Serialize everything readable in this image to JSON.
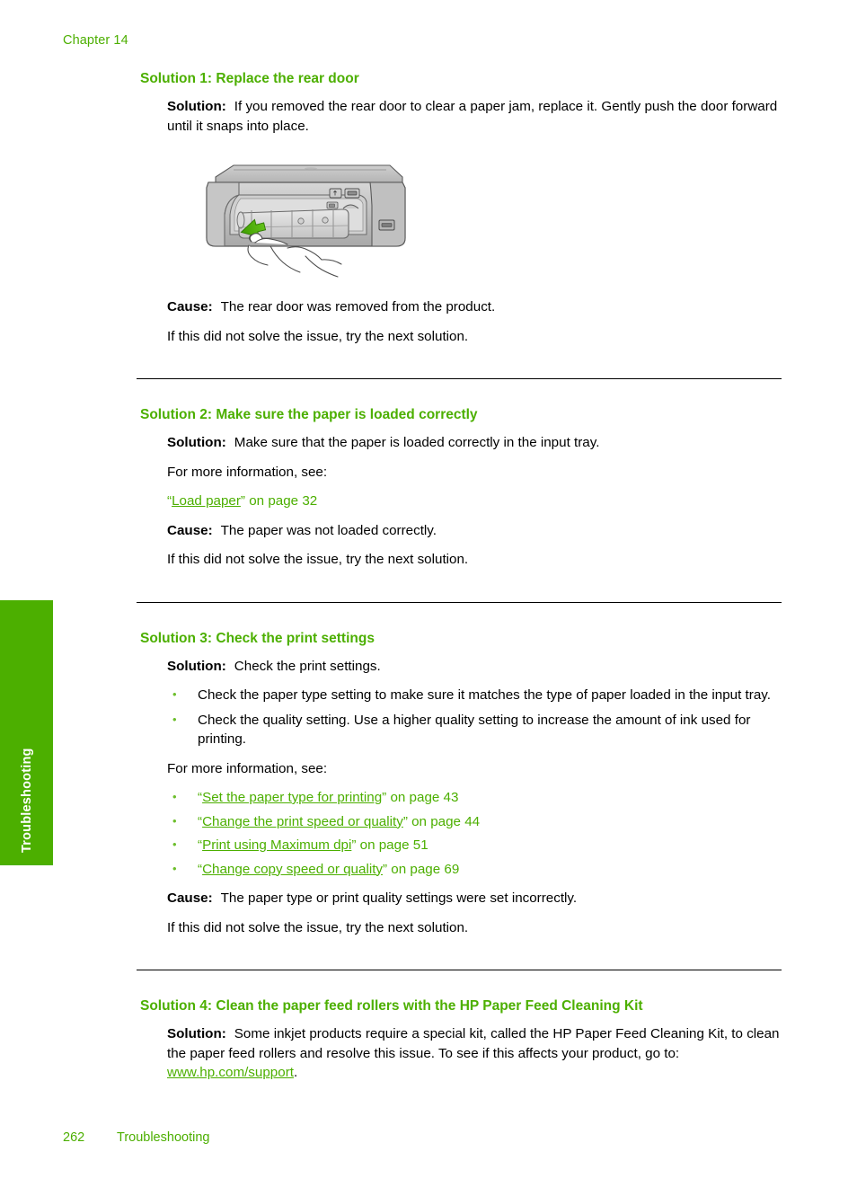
{
  "page": {
    "chapter": "Chapter 14",
    "side_tab": "Troubleshooting",
    "footer_page_number": "262",
    "footer_section": "Troubleshooting",
    "heading_color": "#4CAF00",
    "link_color": "#4CAF00",
    "tab_color": "#4CAF00"
  },
  "solutions": [
    {
      "heading": "Solution 1: Replace the rear door",
      "solution_label": "Solution:",
      "solution_text": "If you removed the rear door to clear a paper jam, replace it. Gently push the door forward until it snaps into place.",
      "figure_alt": "printer-rear-door-illustration",
      "cause_label": "Cause:",
      "cause_text": "The rear door was removed from the product.",
      "next_text": "If this did not solve the issue, try the next solution."
    },
    {
      "heading": "Solution 2: Make sure the paper is loaded correctly",
      "solution_label": "Solution:",
      "solution_text": "Make sure that the paper is loaded correctly in the input tray.",
      "more_info": "For more information, see:",
      "link": {
        "open_quote": "“",
        "title": "Load paper",
        "close_quote": "”",
        "suffix": " on page 32"
      },
      "cause_label": "Cause:",
      "cause_text": "The paper was not loaded correctly.",
      "next_text": "If this did not solve the issue, try the next solution."
    },
    {
      "heading": "Solution 3: Check the print settings",
      "solution_label": "Solution:",
      "solution_text": "Check the print settings.",
      "bullets": [
        "Check the paper type setting to make sure it matches the type of paper loaded in the input tray.",
        "Check the quality setting. Use a higher quality setting to increase the amount of ink used for printing."
      ],
      "more_info": "For more information, see:",
      "links": [
        {
          "open_quote": "“",
          "title": "Set the paper type for printing",
          "close_quote": "”",
          "suffix": " on page 43"
        },
        {
          "open_quote": "“",
          "title": "Change the print speed or quality",
          "close_quote": "”",
          "suffix": " on page 44"
        },
        {
          "open_quote": "“",
          "title": "Print using Maximum dpi",
          "close_quote": "”",
          "suffix": " on page 51"
        },
        {
          "open_quote": "“",
          "title": "Change copy speed or quality",
          "close_quote": "”",
          "suffix": " on page 69"
        }
      ],
      "cause_label": "Cause:",
      "cause_text": "The paper type or print quality settings were set incorrectly.",
      "next_text": "If this did not solve the issue, try the next solution."
    },
    {
      "heading": "Solution 4: Clean the paper feed rollers with the HP Paper Feed Cleaning Kit",
      "solution_label": "Solution:",
      "solution_text_before": "Some inkjet products require a special kit, called the HP Paper Feed Cleaning Kit, to clean the paper feed rollers and resolve this issue. To see if this affects your product, go to: ",
      "url": "www.hp.com/support",
      "solution_text_after": "."
    }
  ]
}
